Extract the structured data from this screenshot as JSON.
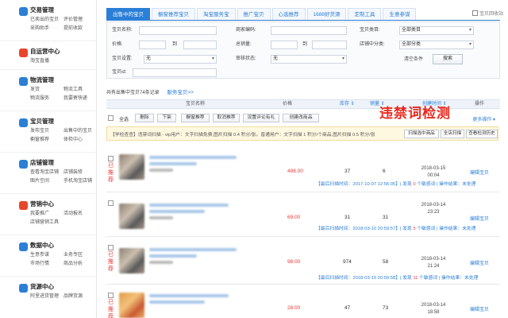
{
  "sidebar": {
    "sections": [
      {
        "title": "交易管理",
        "items": [
          "已卖出的宝贝",
          "评价管理",
          "采购助手",
          "提前收款"
        ]
      },
      {
        "title": "自运营中心",
        "items": [
          "淘宝直播"
        ]
      },
      {
        "title": "物流管理",
        "items": [
          "发货",
          "物流工具",
          "物流服务",
          "我要寄快递"
        ]
      },
      {
        "title": "宝贝管理",
        "items": [
          "发布宝贝",
          "出售中的宝贝",
          "橱窗推荐",
          "体检中心"
        ]
      },
      {
        "title": "店铺管理",
        "items": [
          "查看淘宝店铺",
          "店铺装修",
          "图片空间",
          "手机淘宝店铺"
        ]
      },
      {
        "title": "营销中心",
        "items": [
          "我要推广",
          "活动报名",
          "店铺营销工具"
        ]
      },
      {
        "title": "数据中心",
        "items": [
          "生意参谋",
          "业务专区",
          "市场行情",
          "商品分析"
        ]
      },
      {
        "title": "货源中心",
        "items": [
          "阿里进货管理",
          "品牌货源"
        ]
      }
    ]
  },
  "tabs": [
    "出售中的宝贝",
    "橱窗推荐宝贝",
    "淘宝服务宝",
    "推广宝贝",
    "心选推荐",
    "1688好货源",
    "定制工具",
    "生意参谋"
  ],
  "list_link": "宝贝回收站",
  "filters": {
    "name_label": "宝贝名称:",
    "code_label": "商家编码:",
    "category_label": "宝贝类目:",
    "category_value": "全部类目",
    "price_label": "价格:",
    "to": "到",
    "sales_label": "总销量:",
    "store_cat_label": "店铺中分类:",
    "store_cat_value": "全部分类",
    "setting_label": "宝贝设置:",
    "setting_value": "无",
    "audit_label": "审核状态:",
    "audit_value": "无",
    "id_label": "宝贝id:",
    "clear": "清空条件",
    "search": "搜索"
  },
  "summary": {
    "text": "共有出售中宝贝74条记录",
    "link": "服务宝贝>>"
  },
  "table_headers": {
    "name": "宝贝名称",
    "price": "价格",
    "stock": "库存 ⇕",
    "sales": "销量 ⇕",
    "time": "创建时间 ⇕",
    "ops": "操作"
  },
  "overlay_title": "违禁词检测",
  "toolbar": {
    "select_all": "全选",
    "delete": "删除",
    "off_shelf": "下架",
    "showcase": "橱窗推荐",
    "cancel_rec": "取消推荐",
    "set_discount": "设置评论有礼",
    "create_url": "创建改商品",
    "more": "更多操作 ▾"
  },
  "notice": {
    "text": "【学检查查】违禁词扫描 - vip用户：文字扫描免费,图片扫描 0.4 积分/张。普通用户：文字扫描 1 积分/个商品,图片扫描 0.5 积分/张",
    "btn_scan": "扫描选中商品",
    "btn_all": "全店扫描",
    "btn_history": "查看检测历史"
  },
  "rows": [
    {
      "status": "已推荐",
      "price": "498.00",
      "stock": "37",
      "sales": "6",
      "date": "2018-03-15",
      "time": "00:04",
      "edit": "编辑宝贝",
      "scan_time": "2017-10-07 12:56:05",
      "scan_count": "0",
      "scan_result": "未处理"
    },
    {
      "status": "已推荐",
      "price": "69.00",
      "stock": "31",
      "sales": "31",
      "date": "2018-03-14",
      "time": "23:23",
      "edit": "编辑宝贝",
      "scan_time": "2018-03-10 20:59:57",
      "scan_count": "5",
      "scan_result": "未处理"
    },
    {
      "status": "已推荐",
      "price": "98.00",
      "stock": "974",
      "sales": "58",
      "date": "2018-03-14",
      "time": "21:24",
      "edit": "编辑宝贝",
      "scan_time": "2018-03-10 20:59:58",
      "scan_count": "11",
      "scan_result": "未处理"
    },
    {
      "status": "已推荐",
      "price": "28.00",
      "stock": "47",
      "sales": "73",
      "date": "2018-03-14",
      "time": "18:58",
      "edit": "编辑宝贝",
      "scan_time": "",
      "scan_count": "",
      "scan_result": ""
    }
  ],
  "scan_labels": {
    "last": "【最后扫描时间：",
    "sep": "】| 发现",
    "count_suffix": "个敏感词",
    "result": "| 操作结果："
  }
}
